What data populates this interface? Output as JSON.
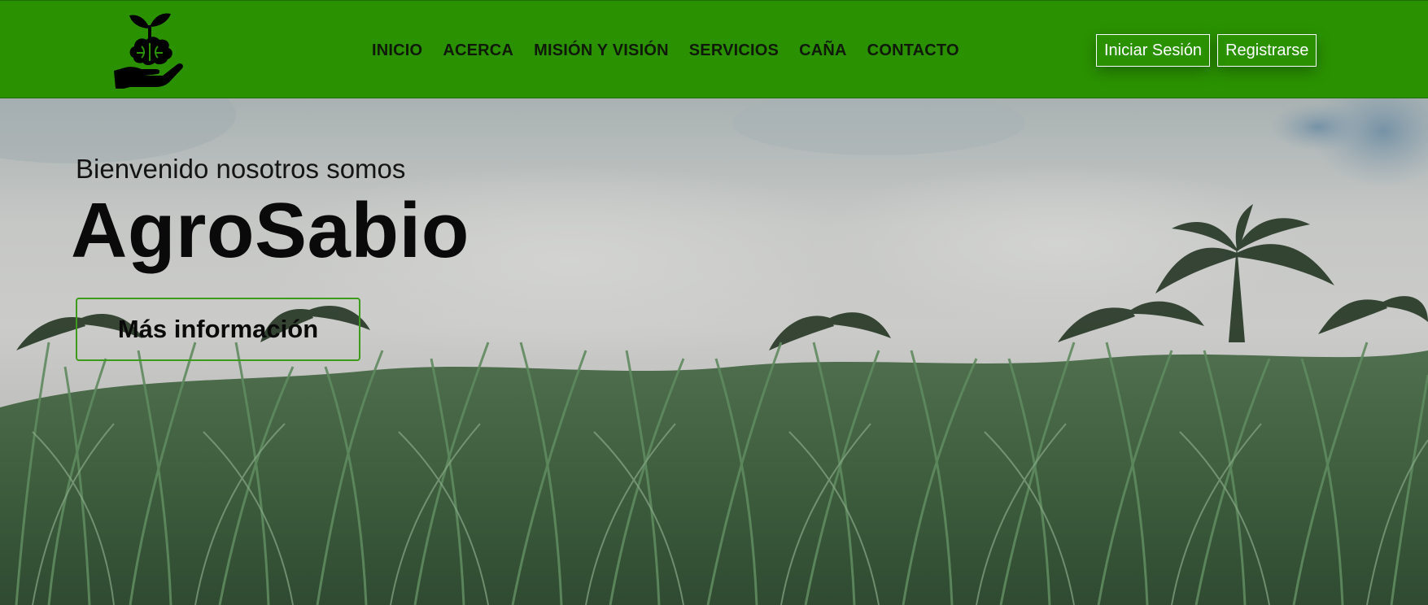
{
  "header": {
    "logo_icon": "plant-brain-hand-icon",
    "nav": [
      {
        "label": "INICIO"
      },
      {
        "label": "ACERCA"
      },
      {
        "label": "MISIÓN Y VISIÓN"
      },
      {
        "label": "SERVICIOS"
      },
      {
        "label": "CAÑA"
      },
      {
        "label": "CONTACTO"
      }
    ],
    "login_label": "Iniciar Sesión",
    "register_label": "Registrarse"
  },
  "hero": {
    "subtitle": "Bienvenido nosotros somos",
    "title": "AgroSabio",
    "cta_label": "Más información",
    "background": "sugarcane-field-photo"
  },
  "colors": {
    "header_bg": "#2a9200",
    "cta_border": "#3c9a1c",
    "text_dark": "#0a0a0a"
  }
}
